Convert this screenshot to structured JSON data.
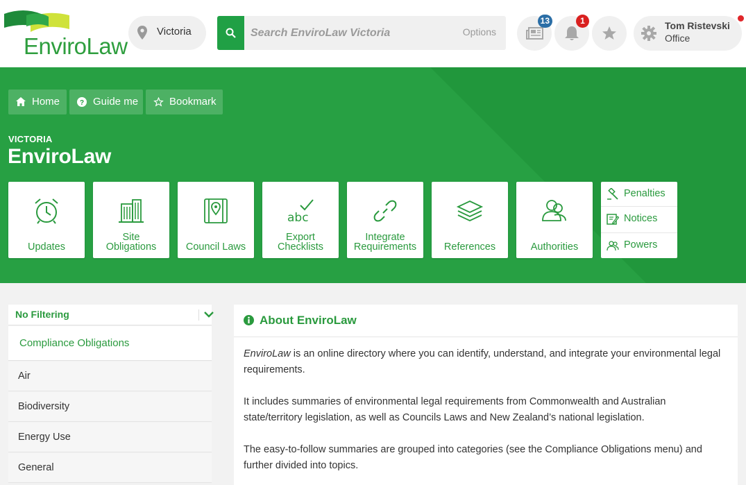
{
  "header": {
    "logo_text": "EnviroLaw",
    "location": "Victoria",
    "search_placeholder": "Search EnviroLaw Victoria",
    "search_options": "Options",
    "news_count": "13",
    "notification_count": "1",
    "user_name": "Tom Ristevski",
    "user_role": "Office"
  },
  "hero": {
    "crumbs": [
      "Home",
      "Guide me",
      "Bookmark"
    ],
    "region": "VICTORIA",
    "title": "EnviroLaw",
    "tiles": [
      {
        "line1": "Updates",
        "line2": ""
      },
      {
        "line1": "Site",
        "line2": "Obligations"
      },
      {
        "line1": "Council Laws",
        "line2": ""
      },
      {
        "line1": "Export",
        "line2": "Checklists"
      },
      {
        "line1": "Integrate",
        "line2": "Requirements"
      },
      {
        "line1": "References",
        "line2": ""
      },
      {
        "line1": "Authorities",
        "line2": ""
      }
    ],
    "side_links": [
      "Penalties",
      "Notices",
      "Powers"
    ]
  },
  "sidebar": {
    "filter": "No Filtering",
    "category": "Compliance Obligations",
    "items": [
      "Air",
      "Biodiversity",
      "Energy Use",
      "General"
    ]
  },
  "main": {
    "heading": "About EnviroLaw",
    "para1_em": "EnviroLaw",
    "para1_rest": " is an online directory where you can identify, understand, and integrate your environmental legal requirements.",
    "para2": "It includes summaries of environmental legal requirements from Commonwealth and Australian state/territory legislation, as well as Councils Laws and New Zealand’s national legislation.",
    "para3": "The easy-to-follow summaries are grouped into categories (see the Compliance Obligations menu) and further divided into topics."
  },
  "colors": {
    "brand_green": "#27a043",
    "text_green": "#2a9a3e",
    "badge_blue": "#2b6ea6",
    "badge_red": "#d9201f"
  }
}
